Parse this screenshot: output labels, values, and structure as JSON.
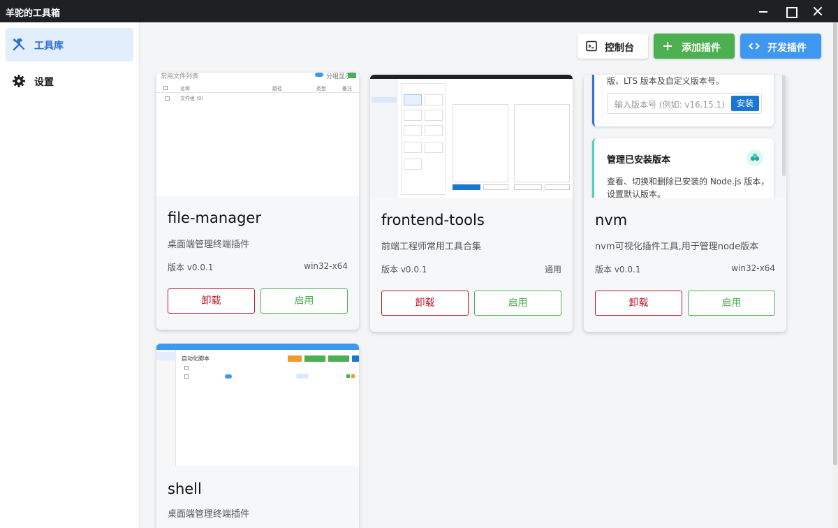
{
  "window": {
    "title": "羊驼的工具箱"
  },
  "sidebar": {
    "items": [
      {
        "label": "工具库",
        "icon": "tools-icon",
        "active": true
      },
      {
        "label": "设置",
        "icon": "gear-icon",
        "active": false
      }
    ]
  },
  "toolbar": {
    "console_label": "控制台",
    "add_label": "添加插件",
    "dev_label": "开发插件"
  },
  "plugins": [
    {
      "name": "file-manager",
      "desc": "桌面端管理终端插件",
      "version": "版本 v0.0.1",
      "platform": "win32-x64",
      "uninstall_label": "卸载",
      "enable_label": "启用"
    },
    {
      "name": "frontend-tools",
      "desc": "前端工程师常用工具合集",
      "version": "版本 v0.0.1",
      "platform": "通用",
      "uninstall_label": "卸载",
      "enable_label": "启用"
    },
    {
      "name": "nvm",
      "desc": "nvm可视化插件工具,用于管理node版本",
      "version": "版本 v0.0.1",
      "platform": "win32-x64",
      "uninstall_label": "卸载",
      "enable_label": "启用"
    },
    {
      "name": "shell",
      "desc": "桌面端管理终端插件"
    }
  ],
  "previews": {
    "file_manager": {
      "header": "常用文件列表",
      "toggle_label": "分组显示",
      "col_name": "名称",
      "col_path": "路径",
      "col_type": "类型",
      "col_note": "备注",
      "row": "文件组 (0)"
    },
    "nvm": {
      "top_text": "版、LTS 版本及自定义版本号。",
      "placeholder": "输入版本号 (例如: v16.15.1)",
      "install_label": "安装",
      "section_title": "管理已安装版本",
      "section_desc_1": "查看、切换和删除已安装的 Node.js 版本，",
      "section_desc_2": "设置默认版本。"
    },
    "shell": {
      "header": "自动化脚本"
    }
  },
  "colors": {
    "titlebar": "#1e2024",
    "accent_blue": "#3e97f0",
    "accent_green": "#4caf50",
    "danger_red": "#b71c2a",
    "sidebar_active_bg": "#e3eefc"
  }
}
